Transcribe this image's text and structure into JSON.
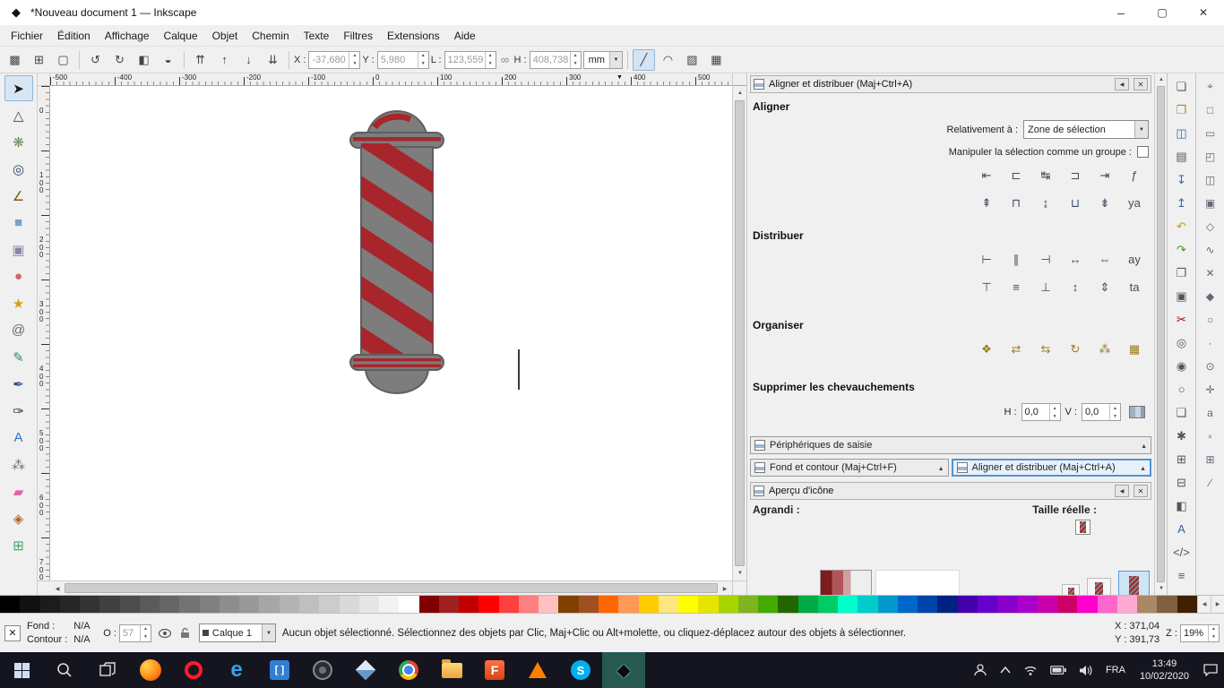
{
  "colors": {
    "accent": "#4f94d4",
    "pole_gray": "#7d7d7d",
    "pole_red": "#a8262b",
    "taskbar_bg": "#15151f",
    "canvas_bg": "#ffffff"
  },
  "title_bar": {
    "title": "*Nouveau document 1 — Inkscape"
  },
  "menu": {
    "items": [
      "Fichier",
      "Édition",
      "Affichage",
      "Calque",
      "Objet",
      "Chemin",
      "Texte",
      "Filtres",
      "Extensions",
      "Aide"
    ]
  },
  "toolbar": {
    "left_buttons": [
      {
        "name": "select-all-button",
        "glyph": "▩"
      },
      {
        "name": "select-all-layers-button",
        "glyph": "⊞"
      },
      {
        "name": "deselect-button",
        "glyph": "▢"
      }
    ],
    "rotate_buttons": [
      {
        "name": "rotate-ccw-button",
        "glyph": "↺"
      },
      {
        "name": "rotate-cw-button",
        "glyph": "↻"
      },
      {
        "name": "flip-horizontal-button",
        "glyph": "◧"
      },
      {
        "name": "flip-vertical-button",
        "glyph": "◒"
      }
    ],
    "zorder_buttons": [
      {
        "name": "raise-to-top-button",
        "glyph": "⇈"
      },
      {
        "name": "raise-button",
        "glyph": "↑"
      },
      {
        "name": "lower-button",
        "glyph": "↓"
      },
      {
        "name": "lower-to-bottom-button",
        "glyph": "⇊"
      }
    ],
    "x_label": "X :",
    "x_value": "-37,680",
    "y_label": "Y :",
    "y_value": "5,980",
    "w_label": "L :",
    "w_value": "123,559",
    "h_label": "H :",
    "h_value": "408,738",
    "lock_glyph": "∞",
    "unit": "mm",
    "toggles": [
      {
        "name": "affect-stroke-toggle",
        "glyph": "╱",
        "pressed": true
      },
      {
        "name": "affect-corners-toggle",
        "glyph": "◠"
      },
      {
        "name": "affect-gradients-toggle",
        "glyph": "▨"
      },
      {
        "name": "affect-patterns-toggle",
        "glyph": "▦"
      }
    ]
  },
  "toolbox": {
    "tools": [
      {
        "name": "selector-tool",
        "glyph": "➤",
        "color": "#1a1a1a",
        "active": true
      },
      {
        "name": "node-tool",
        "glyph": "△",
        "color": "#444455"
      },
      {
        "name": "tweak-tool",
        "glyph": "❋",
        "color": "#6a8a5a"
      },
      {
        "name": "zoom-tool",
        "glyph": "◎",
        "color": "#334466"
      },
      {
        "name": "measure-tool",
        "glyph": "∠",
        "color": "#885511"
      },
      {
        "name": "rectangle-tool",
        "glyph": "■",
        "color": "#7aa2c8"
      },
      {
        "name": "box-3d-tool",
        "glyph": "▣",
        "color": "#8888aa"
      },
      {
        "name": "ellipse-tool",
        "glyph": "●",
        "color": "#d06666"
      },
      {
        "name": "star-tool",
        "glyph": "★",
        "color": "#d4a017"
      },
      {
        "name": "spiral-tool",
        "glyph": "@",
        "color": "#666666"
      },
      {
        "name": "pencil-tool",
        "glyph": "✎",
        "color": "#338866"
      },
      {
        "name": "bezier-tool",
        "glyph": "✒",
        "color": "#335588"
      },
      {
        "name": "calligraphy-tool",
        "glyph": "✑",
        "color": "#333333"
      },
      {
        "name": "text-tool",
        "glyph": "A",
        "color": "#2277cc"
      },
      {
        "name": "spray-tool",
        "glyph": "⁂",
        "color": "#776677"
      },
      {
        "name": "eraser-tool",
        "glyph": "▰",
        "color": "#dd66aa"
      },
      {
        "name": "paint-bucket-tool",
        "glyph": "◈",
        "color": "#aa6633"
      },
      {
        "name": "connector-tool",
        "glyph": "⊞",
        "color": "#33aa66"
      }
    ]
  },
  "canvas": {
    "h_ruler_labels": [
      "-500",
      "-400",
      "-300",
      "-200",
      "-100",
      "0",
      "100",
      "200",
      "300",
      "400",
      "500"
    ],
    "v_ruler_labels": [
      "0",
      "100",
      "200",
      "300",
      "400",
      "500",
      "600",
      "700"
    ],
    "ruler_marker": "▼"
  },
  "align_panel": {
    "title": "Aligner et distribuer (Maj+Ctrl+A)",
    "align_label": "Aligner",
    "relative_label": "Relativement à :",
    "relative_value": "Zone de sélection",
    "group_label": "Manipuler la sélection comme un groupe :",
    "distribute_label": "Distribuer",
    "arrange_label": "Organiser",
    "overlap_label": "Supprimer les chevauchements",
    "h_label": "H :",
    "h_value": "0,0",
    "v_label": "V :",
    "v_value": "0,0",
    "align_row1": [
      {
        "name": "align-right-to-anchor-left-button",
        "glyph": "⇤"
      },
      {
        "name": "align-left-edges-button",
        "glyph": "⊏"
      },
      {
        "name": "center-on-vertical-axis-button",
        "glyph": "↹"
      },
      {
        "name": "align-right-edges-button",
        "glyph": "⊐"
      },
      {
        "name": "align-left-to-anchor-right-button",
        "glyph": "⇥"
      },
      {
        "name": "text-anchor-horizontal-button",
        "glyph": "ƒ"
      }
    ],
    "align_row2": [
      {
        "name": "align-bottom-to-anchor-top-button",
        "glyph": "⇞"
      },
      {
        "name": "align-top-edges-button",
        "glyph": "⊓"
      },
      {
        "name": "center-on-horizontal-axis-button",
        "glyph": "↨"
      },
      {
        "name": "align-bottom-edges-button",
        "glyph": "⊔"
      },
      {
        "name": "align-top-to-anchor-bottom-button",
        "glyph": "⇟"
      },
      {
        "name": "text-baseline-align-button",
        "glyph": "ya"
      }
    ],
    "dist_row1": [
      {
        "name": "distribute-left-edges-button",
        "glyph": "⊢"
      },
      {
        "name": "distribute-centers-horizontally-button",
        "glyph": "∥"
      },
      {
        "name": "distribute-right-edges-button",
        "glyph": "⊣"
      },
      {
        "name": "make-horizontal-gaps-equal-button",
        "glyph": "↔"
      },
      {
        "name": "distribute-horizontal-anchors-button",
        "glyph": "⇔"
      },
      {
        "name": "distribute-text-anchors-button",
        "glyph": "ay"
      }
    ],
    "dist_row2": [
      {
        "name": "distribute-top-edges-button",
        "glyph": "⊤"
      },
      {
        "name": "distribute-centers-vertically-button",
        "glyph": "≡"
      },
      {
        "name": "distribute-bottom-edges-button",
        "glyph": "⊥"
      },
      {
        "name": "make-vertical-gaps-equal-button",
        "glyph": "↕"
      },
      {
        "name": "distribute-vertical-anchors-button",
        "glyph": "⇕"
      },
      {
        "name": "distribute-text-baselines-button",
        "glyph": "ta"
      }
    ],
    "arrange_row": [
      {
        "name": "arrange-as-graph-button",
        "glyph": "❖"
      },
      {
        "name": "exchange-positions-selection-order-button",
        "glyph": "⇄"
      },
      {
        "name": "exchange-positions-stacking-order-button",
        "glyph": "⇆"
      },
      {
        "name": "exchange-positions-clockwise-button",
        "glyph": "↻"
      },
      {
        "name": "randomize-positions-button",
        "glyph": "⁂"
      },
      {
        "name": "unclump-button",
        "glyph": "▦"
      }
    ]
  },
  "docked_bars": {
    "input_devices": "Périphériques de saisie",
    "fill_stroke_tab": "Fond et contour (Maj+Ctrl+F)",
    "align_tab": "Aligner et distribuer (Maj+Ctrl+A)"
  },
  "icon_preview": {
    "title": "Aperçu d'icône",
    "magnified_label": "Agrandi :",
    "actual_label": "Taille réelle :"
  },
  "commands_bar": {
    "items": [
      {
        "name": "new-document-button",
        "glyph": "❏",
        "color": "#555555"
      },
      {
        "name": "open-document-button",
        "glyph": "❒",
        "color": "#b08030"
      },
      {
        "name": "save-document-button",
        "glyph": "◫",
        "color": "#3465a4"
      },
      {
        "name": "print-button",
        "glyph": "▤",
        "color": "#555555"
      },
      {
        "name": "import-button",
        "glyph": "↧",
        "color": "#3465a4"
      },
      {
        "name": "export-button",
        "glyph": "↥",
        "color": "#3465a4"
      },
      {
        "name": "undo-button",
        "glyph": "↶",
        "color": "#c4a000"
      },
      {
        "name": "redo-button",
        "glyph": "↷",
        "color": "#4e9a06"
      },
      {
        "name": "copy-button",
        "glyph": "❐",
        "color": "#555555"
      },
      {
        "name": "paste-button",
        "glyph": "▣",
        "color": "#555555"
      },
      {
        "name": "cut-button",
        "glyph": "✂",
        "color": "#a40000"
      },
      {
        "name": "zoom-selection-button",
        "glyph": "◎",
        "color": "#555555"
      },
      {
        "name": "zoom-drawing-button",
        "glyph": "◉",
        "color": "#555555"
      },
      {
        "name": "zoom-page-button",
        "glyph": "○",
        "color": "#555555"
      },
      {
        "name": "duplicate-button",
        "glyph": "❑",
        "color": "#555555"
      },
      {
        "name": "create-clone-button",
        "glyph": "✱",
        "color": "#555555"
      },
      {
        "name": "group-button",
        "glyph": "⊞",
        "color": "#555555"
      },
      {
        "name": "ungroup-button",
        "glyph": "⊟",
        "color": "#555555"
      },
      {
        "name": "fill-stroke-dialog-button",
        "glyph": "◧",
        "color": "#555555"
      },
      {
        "name": "text-dialog-button",
        "glyph": "A",
        "color": "#3465a4"
      },
      {
        "name": "xml-editor-button",
        "glyph": "</>",
        "color": "#555555"
      },
      {
        "name": "align-dialog-button",
        "glyph": "≡",
        "color": "#555555"
      }
    ]
  },
  "snap_bar": {
    "items": [
      {
        "name": "snap-toggle-button",
        "glyph": "⌖"
      },
      {
        "name": "snap-bounding-box-button",
        "glyph": "□"
      },
      {
        "name": "snap-bbox-edges-button",
        "glyph": "▭"
      },
      {
        "name": "snap-bbox-corners-button",
        "glyph": "◰"
      },
      {
        "name": "snap-bbox-edge-midpoints-button",
        "glyph": "◫"
      },
      {
        "name": "snap-bbox-centers-button",
        "glyph": "▣"
      },
      {
        "name": "snap-nodes-button",
        "glyph": "◇"
      },
      {
        "name": "snap-paths-button",
        "glyph": "∿"
      },
      {
        "name": "snap-path-intersections-button",
        "glyph": "✕"
      },
      {
        "name": "snap-cusp-nodes-button",
        "glyph": "◆"
      },
      {
        "name": "snap-smooth-nodes-button",
        "glyph": "○"
      },
      {
        "name": "snap-midpoints-button",
        "glyph": "·"
      },
      {
        "name": "snap-object-centers-button",
        "glyph": "⊙"
      },
      {
        "name": "snap-rotation-centers-button",
        "glyph": "✛"
      },
      {
        "name": "snap-text-baseline-button",
        "glyph": "a"
      },
      {
        "name": "snap-page-border-button",
        "glyph": "▫"
      },
      {
        "name": "snap-grids-button",
        "glyph": "⊞"
      },
      {
        "name": "snap-guides-button",
        "glyph": "∕"
      }
    ]
  },
  "palette": {
    "colors": [
      "#000000",
      "#111111",
      "#1c1c1c",
      "#262626",
      "#333333",
      "#404040",
      "#4d4d4d",
      "#5a5a5a",
      "#666666",
      "#737373",
      "#808080",
      "#8d8d8d",
      "#999999",
      "#a6a6a6",
      "#b3b3b3",
      "#bfbfbf",
      "#cccccc",
      "#d9d9d9",
      "#e6e6e6",
      "#f2f2f2",
      "#ffffff",
      "#800000",
      "#a02020",
      "#c00000",
      "#ff0000",
      "#ff4040",
      "#ff8080",
      "#ffc0c0",
      "#804000",
      "#a05020",
      "#ff6600",
      "#ff9955",
      "#ffcc00",
      "#ffe680",
      "#ffff00",
      "#e5e500",
      "#aad400",
      "#80b320",
      "#44aa00",
      "#226600",
      "#00aa44",
      "#00cc66",
      "#00ffcc",
      "#00cccc",
      "#0099cc",
      "#0066cc",
      "#0044aa",
      "#002280",
      "#4400aa",
      "#6600cc",
      "#8800cc",
      "#aa00cc",
      "#cc00aa",
      "#cc0066",
      "#ff00cc",
      "#ff66cc",
      "#ffaad4",
      "#aa8866",
      "#806040",
      "#402000"
    ]
  },
  "status_bar": {
    "none_glyph": "✕",
    "fill_label": "Fond :",
    "fill_value": "N/A",
    "stroke_label": "Contour :",
    "stroke_value": "N/A",
    "opacity_label": "O :",
    "opacity_value": "57",
    "layer_name": "Calque 1",
    "message": "Aucun objet sélectionné. Sélectionnez des objets par Clic, Maj+Clic ou Alt+molette, ou cliquez-déplacez autour des objets à sélectionner.",
    "x_label": "X :",
    "x_value": "371,04",
    "y_label": "Y :",
    "y_value": "391,73",
    "z_label": "Z :",
    "zoom_value": "19%"
  },
  "taskbar": {
    "apps": [
      {
        "name": "taskbar-firefox-icon",
        "kind": "ico-firefox",
        "letter": ""
      },
      {
        "name": "taskbar-opera-icon",
        "kind": "ico-opera",
        "letter": ""
      },
      {
        "name": "taskbar-edge-icon",
        "kind": "ico-edge",
        "letter": "e"
      },
      {
        "name": "taskbar-window-app-icon",
        "kind": "ico-window",
        "letter": "[ ]"
      },
      {
        "name": "taskbar-camera-app-icon",
        "kind": "ico-camera",
        "letter": ""
      },
      {
        "name": "taskbar-pinwheel-app-icon",
        "kind": "ico-pinwheel",
        "letter": ""
      },
      {
        "name": "taskbar-chrome-icon",
        "kind": "ico-chrome",
        "letter": ""
      },
      {
        "name": "taskbar-explorer-icon",
        "kind": "ico-folder",
        "letter": ""
      },
      {
        "name": "taskbar-f-app-icon",
        "kind": "ico-f",
        "letter": "F"
      },
      {
        "name": "taskbar-vlc-icon",
        "kind": "ico-vlc",
        "letter": ""
      },
      {
        "name": "taskbar-skype-icon",
        "kind": "ico-skype",
        "letter": "S"
      },
      {
        "name": "taskbar-inkscape-icon",
        "kind": "ico-inkscape",
        "letter": "◆",
        "active": true
      }
    ],
    "tray": {
      "lang": "FRA",
      "time": "13:49",
      "date": "10/02/2020"
    }
  }
}
